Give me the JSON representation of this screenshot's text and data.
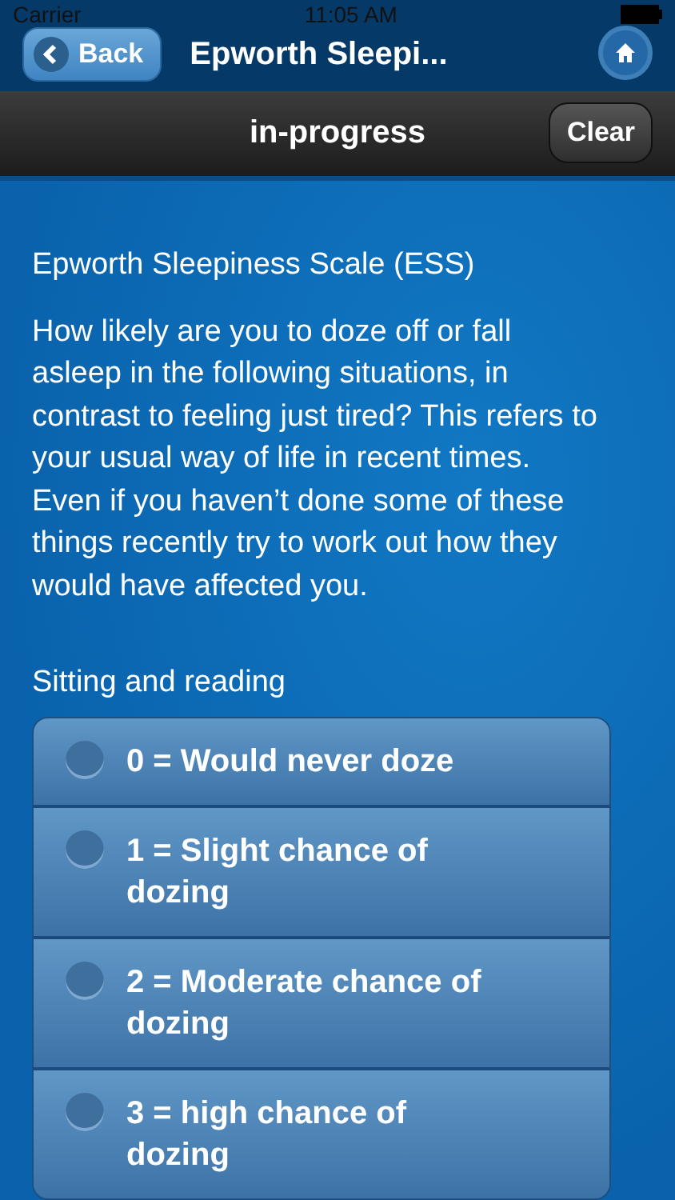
{
  "status_bar": {
    "carrier": "Carrier",
    "time": "11:05 AM"
  },
  "header": {
    "back": "Back",
    "title": "Epworth Sleepi..."
  },
  "toolbar": {
    "title": "in-progress",
    "clear": "Clear"
  },
  "heading": "Epworth Sleepiness Scale (ESS)",
  "intro": "How likely are you to doze off or fall asleep in the following situations, in contrast to feeling just tired? This refers to your usual way of life in recent times. Even if you haven’t done some of these things recently try to work out how they would have affected you.",
  "question": {
    "label": "Sitting and reading",
    "options": [
      {
        "label": "0 = Would never doze",
        "selected": false
      },
      {
        "label": "1 = Slight chance of dozing",
        "selected": false
      },
      {
        "label": "2 = Moderate chance of dozing",
        "selected": false
      },
      {
        "label": "3 = high chance of dozing",
        "selected": false
      }
    ]
  }
}
